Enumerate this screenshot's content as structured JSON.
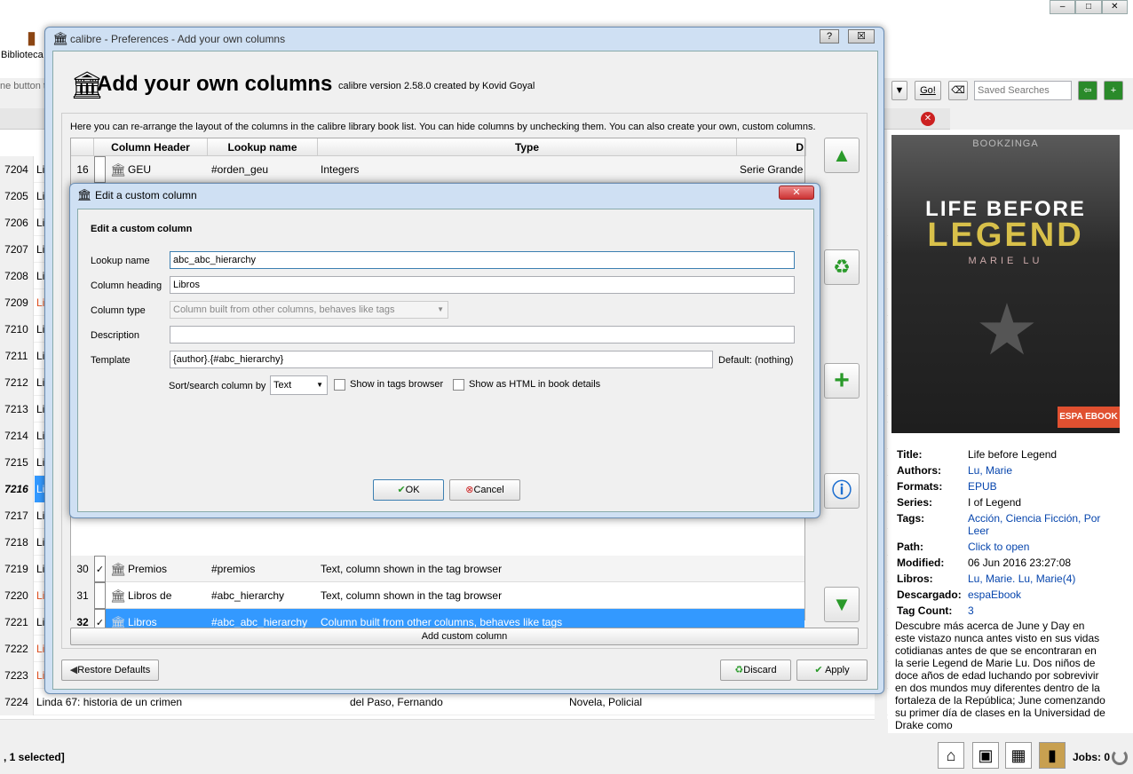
{
  "background": {
    "toolbar_label": "Biblioteca",
    "search_hint": "ne button t",
    "go_label": "Go!",
    "saved_searches": "Saved Searches",
    "book_rows": [
      {
        "num": "7204",
        "text": "Li"
      },
      {
        "num": "7205",
        "text": "Li"
      },
      {
        "num": "7206",
        "text": "Li"
      },
      {
        "num": "7207",
        "text": "Li"
      },
      {
        "num": "7208",
        "text": "Li"
      },
      {
        "num": "7209",
        "text": "Li"
      },
      {
        "num": "7210",
        "text": "Li"
      },
      {
        "num": "7211",
        "text": "Li"
      },
      {
        "num": "7212",
        "text": "Li"
      },
      {
        "num": "7213",
        "text": "Li"
      },
      {
        "num": "7214",
        "text": "Li"
      },
      {
        "num": "7215",
        "text": "Li"
      },
      {
        "num": "7216",
        "text": "Li"
      },
      {
        "num": "7217",
        "text": "Li"
      },
      {
        "num": "7218",
        "text": "Li"
      },
      {
        "num": "7219",
        "text": "Li"
      },
      {
        "num": "7220",
        "text": "Li"
      },
      {
        "num": "7221",
        "text": "Li"
      },
      {
        "num": "7222",
        "text": "Li"
      },
      {
        "num": "7223",
        "text": "Li"
      }
    ],
    "last_row": {
      "num": "7224",
      "title": "Linda 67: historia de un crimen",
      "author": "del Paso, Fernando",
      "tags": "Novela, Policial"
    },
    "status": ", 1 selected]",
    "jobs": "Jobs: 0"
  },
  "book_details": {
    "cover": {
      "publisher": "BOOKZINGA",
      "line1": "LIFE BEFORE",
      "line2": "LEGEND",
      "author": "MARIE LU",
      "badge": "ESPA EBOOK"
    },
    "fields": [
      {
        "label": "Title:",
        "value": "Life before Legend"
      },
      {
        "label": "Authors:",
        "value": "Lu, Marie"
      },
      {
        "label": "Formats:",
        "value": "EPUB"
      },
      {
        "label": "Series:",
        "value": "I of Legend"
      },
      {
        "label": "Tags:",
        "value": "Acción, Ciencia Ficción, Por"
      },
      {
        "label": "",
        "value": "Leer"
      },
      {
        "label": "Path:",
        "value": "Click to open"
      },
      {
        "label": "Modified:",
        "value": "06 Jun 2016 23:27:08"
      },
      {
        "label": "Libros:",
        "value": "Lu, Marie. Lu, Marie(4)"
      },
      {
        "label": "Descargado:",
        "value": "espaEbook"
      },
      {
        "label": "Tag Count:",
        "value": "3"
      }
    ],
    "comments": "Descubre más acerca de June y Day en este vistazo nunca antes visto en sus vidas cotidianas antes de que se encontraran en la serie Legend de Marie Lu. Dos niños de doce años de edad luchando por sobrevivir en dos mundos muy diferentes dentro de la fortaleza de la República; June comenzando su primer día de clases en la Universidad de Drake como"
  },
  "preferences": {
    "window_title": "calibre - Preferences - Add your own columns",
    "help": "?",
    "close": "☒",
    "heading": "Add your own columns",
    "version": "calibre version 2.58.0 created by Kovid Goyal",
    "intro": "Here you can re-arrange the layout of the columns in the calibre library book list. You can hide columns by unchecking them. You can also create your own, custom columns.",
    "headers": {
      "col1": "Column Header",
      "col2": "Lookup name",
      "col3": "Type",
      "col4": "D"
    },
    "rows_top": [
      {
        "num": "16",
        "checked": "",
        "header": "GEU",
        "lookup": "#orden_geu",
        "type": "Integers",
        "desc": "Serie Grandes"
      }
    ],
    "rows_bottom": [
      {
        "num": "30",
        "checked": "✓",
        "header": "Premios",
        "lookup": "#premios",
        "type": "Text, column shown in the tag browser",
        "desc": ""
      },
      {
        "num": "31",
        "checked": "",
        "header": "Libros de",
        "lookup": "#abc_hierarchy",
        "type": "Text, column shown in the tag browser",
        "desc": ""
      },
      {
        "num": "32",
        "checked": "✓",
        "header": "Libros",
        "lookup": "#abc_abc_hierarchy",
        "type": "Column built from other columns, behaves like tags",
        "desc": ""
      }
    ],
    "add_custom_column": "Add custom column",
    "restore_defaults": "Restore Defaults",
    "discard": "Discard",
    "apply": "Apply"
  },
  "dialog": {
    "title": "Edit a custom column",
    "heading": "Edit a custom column",
    "lookup_label": "Lookup name",
    "lookup_value": "abc_abc_hierarchy",
    "heading_label": "Column heading",
    "heading_value": "Libros",
    "type_label": "Column type",
    "type_value": "Column built from other columns, behaves like tags",
    "description_label": "Description",
    "description_value": "",
    "template_label": "Template",
    "template_value": "{author}.{#abc_hierarchy}",
    "default_label": "Default: (nothing)",
    "sort_label": "Sort/search column by",
    "sort_value": "Text",
    "show_tags": "Show in tags browser",
    "show_html": "Show as HTML in book details",
    "ok": "OK",
    "cancel": "Cancel"
  }
}
